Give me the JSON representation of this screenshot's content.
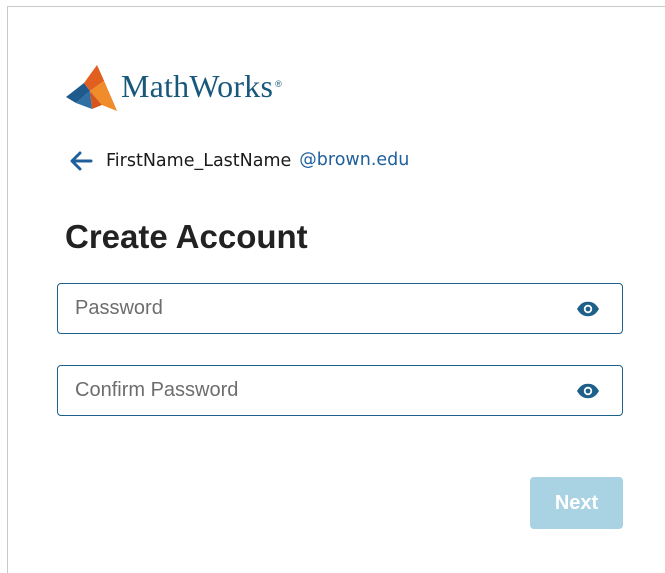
{
  "brand": {
    "name": "MathWorks",
    "registered_mark": "®",
    "color": "#17587b"
  },
  "account": {
    "username": "FirstName_LastName",
    "domain": "@brown.edu",
    "back_icon": "arrow-left-icon"
  },
  "page": {
    "title": "Create Account"
  },
  "form": {
    "password": {
      "value": "",
      "placeholder": "Password",
      "toggle_icon": "eye-icon"
    },
    "confirm_password": {
      "value": "",
      "placeholder": "Confirm Password",
      "toggle_icon": "eye-icon"
    },
    "next_label": "Next",
    "next_enabled": false
  },
  "colors": {
    "accent": "#1d6089",
    "link": "#1f5f9b",
    "button_disabled": "#a9d2e3",
    "title": "#222222"
  }
}
